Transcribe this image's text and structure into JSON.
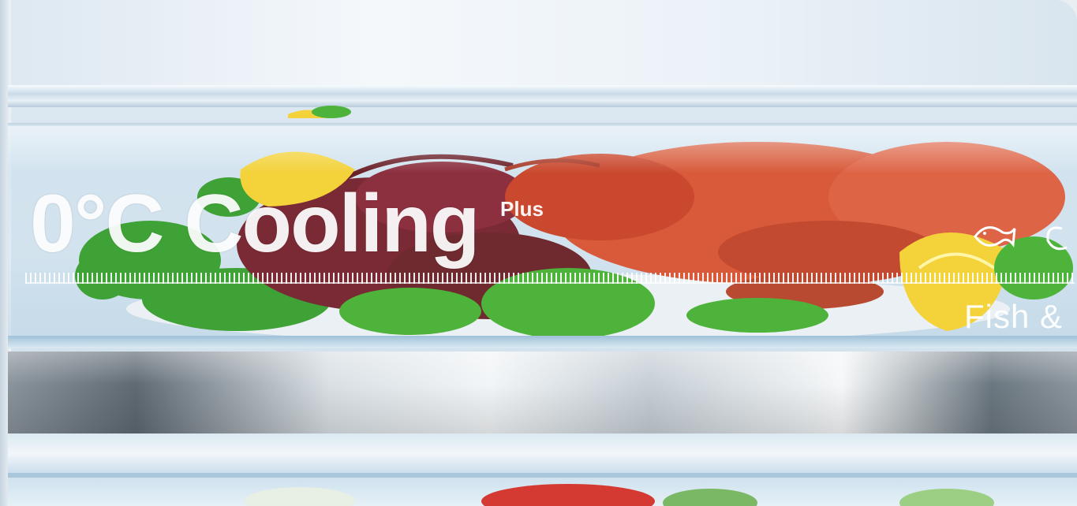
{
  "label": {
    "main": "0°C Cooling",
    "superscript": "Plus",
    "zone": "Fish &"
  },
  "colors": {
    "lobster": "#d85a3a",
    "lettuce": "#3fa236",
    "lemon": "#f3d23a",
    "glass": "#d5e5f0",
    "handle": "#6b7780"
  },
  "icons": [
    "fish-icon",
    "shrimp-icon"
  ]
}
